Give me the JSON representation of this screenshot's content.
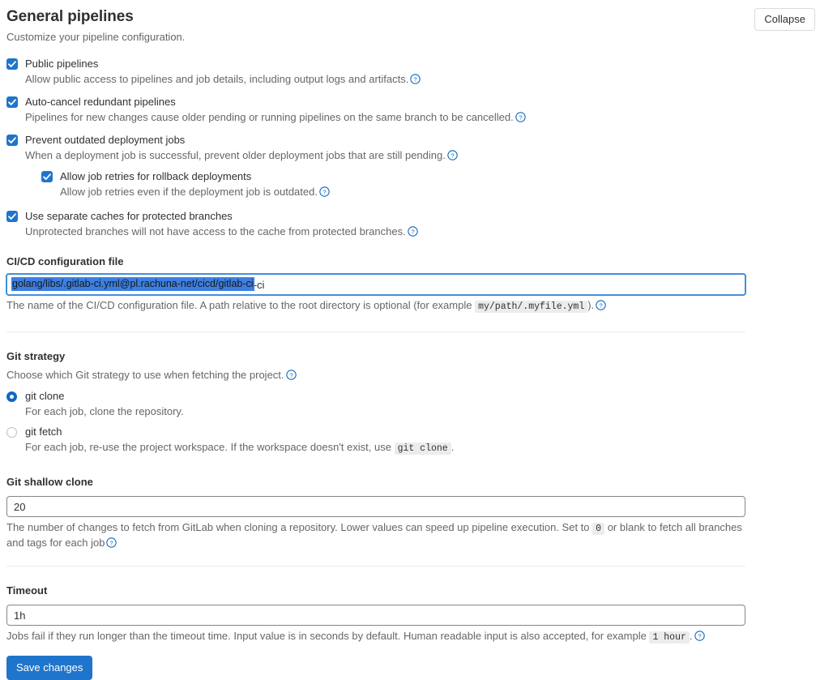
{
  "header": {
    "title": "General pipelines",
    "subtitle": "Customize your pipeline configuration.",
    "collapse_label": "Collapse"
  },
  "checkboxes": [
    {
      "label": "Public pipelines",
      "description": "Allow public access to pipelines and job details, including output logs and artifacts.",
      "checked": true,
      "nested": false
    },
    {
      "label": "Auto-cancel redundant pipelines",
      "description": "Pipelines for new changes cause older pending or running pipelines on the same branch to be cancelled.",
      "checked": true,
      "nested": false
    },
    {
      "label": "Prevent outdated deployment jobs",
      "description": "When a deployment job is successful, prevent older deployment jobs that are still pending.",
      "checked": true,
      "nested": false
    },
    {
      "label": "Allow job retries for rollback deployments",
      "description": "Allow job retries even if the deployment job is outdated.",
      "checked": true,
      "nested": true
    },
    {
      "label": "Use separate caches for protected branches",
      "description": "Unprotected branches will not have access to the cache from protected branches.",
      "checked": true,
      "nested": false
    }
  ],
  "config_file": {
    "label": "CI/CD configuration file",
    "value": "golang/libs/.gitlab-ci.yml@pl.rachuna-net/cicd/gitlab-ci",
    "selected": true,
    "help_before": "The name of the CI/CD configuration file. A path relative to the root directory is optional (for example",
    "help_code": "my/path/.myfile.yml",
    "help_after": ")."
  },
  "git_strategy": {
    "label": "Git strategy",
    "description": "Choose which Git strategy to use when fetching the project.",
    "options": [
      {
        "label": "git clone",
        "description": "For each job, clone the repository.",
        "selected": true
      },
      {
        "label": "git fetch",
        "description_before": "For each job, re-use the project workspace. If the workspace doesn't exist, use",
        "description_code": "git clone",
        "description_after": ".",
        "selected": false
      }
    ]
  },
  "shallow_clone": {
    "label": "Git shallow clone",
    "value": "20",
    "help_before": "The number of changes to fetch from GitLab when cloning a repository. Lower values can speed up pipeline execution. Set to",
    "help_code": "0",
    "help_after": "or blank to fetch all branches and tags for each job"
  },
  "timeout": {
    "label": "Timeout",
    "value": "1h",
    "help_before": "Jobs fail if they run longer than the timeout time. Input value is in seconds by default. Human readable input is also accepted, for example",
    "help_code": "1 hour",
    "help_after": "."
  },
  "save": {
    "label": "Save changes"
  },
  "colors": {
    "accent": "#1f75cb",
    "link": "#1068bf",
    "selection": "#3d7fe0",
    "text": "#303030",
    "muted": "#666666",
    "border": "#868686",
    "divider": "#ededed"
  }
}
